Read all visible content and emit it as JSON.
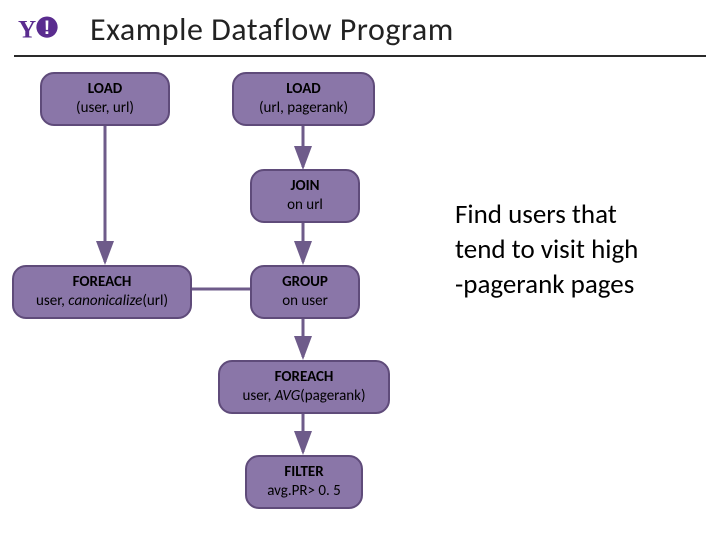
{
  "header": {
    "title": "Example Dataflow Program",
    "logo_alt": "Yahoo logo"
  },
  "nodes": {
    "load1": {
      "op": "LOAD",
      "args": "(user, url)"
    },
    "load2": {
      "op": "LOAD",
      "args": "(url, pagerank)"
    },
    "foreach1": {
      "op": "FOREACH",
      "arg_plain_pre": "user, ",
      "arg_italic": "canonicalize",
      "arg_plain_post": "(url)"
    },
    "join": {
      "op": "JOIN",
      "args": "on url"
    },
    "group": {
      "op": "GROUP",
      "args": "on user"
    },
    "foreach2": {
      "op": "FOREACH",
      "arg_plain_pre": "user, ",
      "arg_italic": "AVG",
      "arg_plain_post": "(pagerank)"
    },
    "filter": {
      "op": "FILTER",
      "args": "avg.PR> 0. 5"
    }
  },
  "annotation": {
    "line1": "Find users that",
    "line2": "tend to visit high",
    "line3": "-pagerank pages"
  }
}
